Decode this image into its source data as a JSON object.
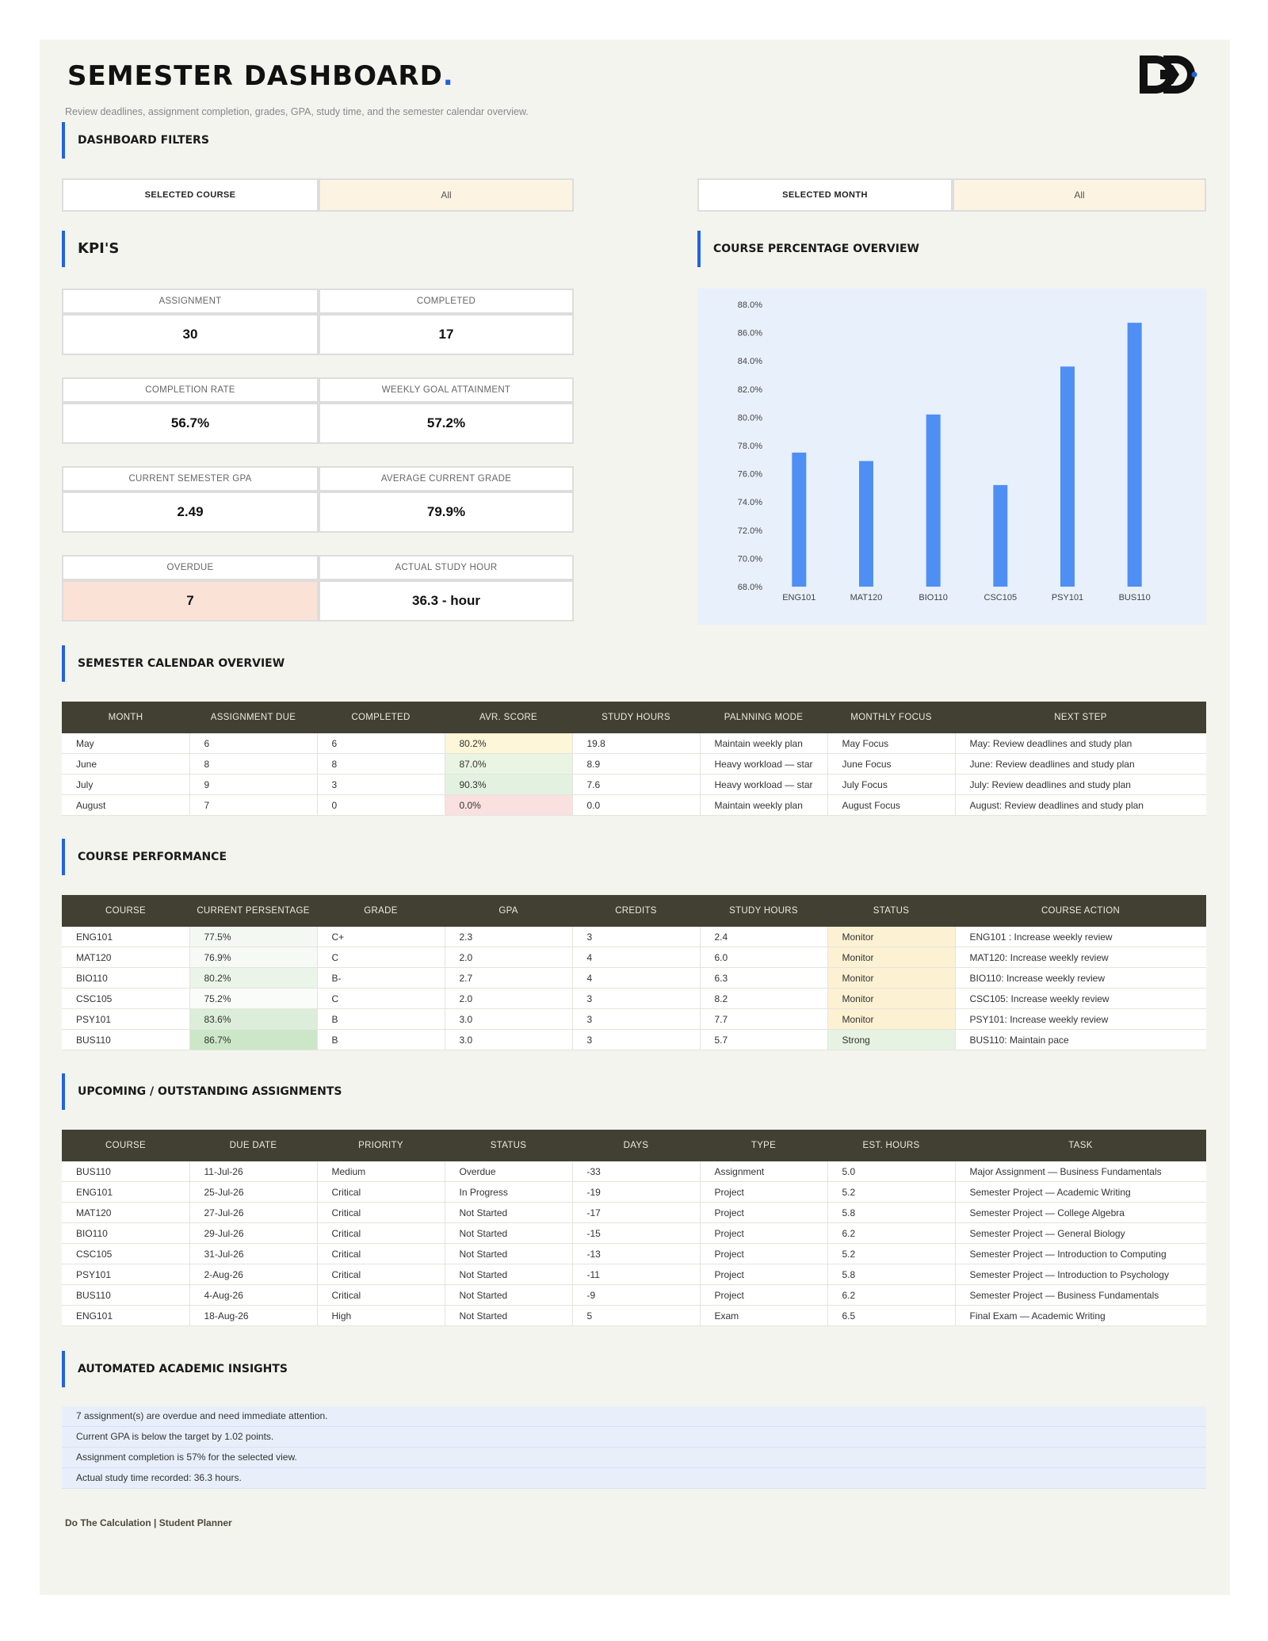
{
  "header": {
    "title": "SEMESTER DASHBOARD",
    "title_dot": ".",
    "subtitle": "Review deadlines, assignment completion, grades, GPA, study time, and the semester calendar overview."
  },
  "sections": {
    "filters": "DASHBOARD FILTERS",
    "kpis": "KPI'S",
    "course_overview": "COURSE PERCENTAGE OVERVIEW",
    "calendar": "SEMESTER CALENDAR OVERVIEW",
    "performance": "COURSE PERFORMANCE",
    "assignments": "UPCOMING / OUTSTANDING ASSIGNMENTS",
    "insights": "AUTOMATED ACADEMIC INSIGHTS"
  },
  "filters": {
    "course_label": "SELECTED COURSE",
    "course_value": "All",
    "month_label": "SELECTED MONTH",
    "month_value": "All"
  },
  "kpis": {
    "assignment_label": "ASSIGNMENT",
    "assignment_value": "30",
    "completed_label": "COMPLETED",
    "completed_value": "17",
    "completion_rate_label": "COMPLETION RATE",
    "completion_rate_value": "56.7%",
    "weekly_goal_label": "WEEKLY GOAL ATTAINMENT",
    "weekly_goal_value": "57.2%",
    "gpa_label": "CURRENT SEMESTER GPA",
    "gpa_value": "2.49",
    "avg_grade_label": "AVERAGE CURRENT GRADE",
    "avg_grade_value": "79.9%",
    "overdue_label": "OVERDUE",
    "overdue_value": "7",
    "study_hour_label": "ACTUAL STUDY HOUR",
    "study_hour_value": "36.3 - hour"
  },
  "colors": {
    "accent": "#2363e0",
    "bar": "#4f8ff4",
    "header_bg": "#414033",
    "overdue_bg": "#fbe2d6",
    "cream": "#fdf3e2"
  },
  "chart_data": {
    "type": "bar",
    "categories": [
      "ENG101",
      "MAT120",
      "BIO110",
      "CSC105",
      "PSY101",
      "BUS110"
    ],
    "values": [
      77.5,
      76.9,
      80.2,
      75.2,
      83.6,
      86.7
    ],
    "ylim": [
      68,
      88
    ],
    "yticks": [
      "68.0%",
      "70.0%",
      "72.0%",
      "74.0%",
      "76.0%",
      "78.0%",
      "80.0%",
      "82.0%",
      "84.0%",
      "86.0%",
      "88.0%"
    ],
    "ytick_values": [
      68,
      70,
      72,
      74,
      76,
      78,
      80,
      82,
      84,
      86,
      88
    ],
    "grid": false,
    "legend": "none"
  },
  "calendar": {
    "headers": [
      "MONTH",
      "ASSIGNMENT DUE",
      "COMPLETED",
      "AVR. SCORE",
      "STUDY HOURS",
      "PALNNING MODE",
      "MONTHLY FOCUS",
      "NEXT STEP"
    ],
    "rows": [
      [
        "May",
        "6",
        "6",
        "80.2%",
        "19.8",
        "Maintain weekly plan",
        "May Focus",
        "May: Review deadlines and study plan"
      ],
      [
        "June",
        "8",
        "8",
        "87.0%",
        "8.9",
        "Heavy workload — star",
        "June Focus",
        "June: Review deadlines and study plan"
      ],
      [
        "July",
        "9",
        "3",
        "90.3%",
        "7.6",
        "Heavy workload — star",
        "July Focus",
        "July: Review deadlines and study plan"
      ],
      [
        "August",
        "7",
        "0",
        "0.0%",
        "0.0",
        "Maintain weekly plan",
        "August Focus",
        "August: Review deadlines and study plan"
      ]
    ],
    "score_colors": [
      "#fdf6d8",
      "#eaf4e3",
      "#e3f1e1",
      "#fbe0e0"
    ]
  },
  "performance": {
    "headers": [
      "COURSE",
      "CURRENT PERSENTAGE",
      "GRADE",
      "GPA",
      "CREDITS",
      "STUDY HOURS",
      "STATUS",
      "COURSE ACTION"
    ],
    "rows": [
      [
        "ENG101",
        "77.5%",
        "C+",
        "2.3",
        "3",
        "2.4",
        "Monitor",
        "ENG101 : Increase weekly review"
      ],
      [
        "MAT120",
        "76.9%",
        "C",
        "2.0",
        "4",
        "6.0",
        "Monitor",
        "MAT120: Increase weekly review"
      ],
      [
        "BIO110",
        "80.2%",
        "B-",
        "2.7",
        "4",
        "6.3",
        "Monitor",
        "BIO110: Increase weekly review"
      ],
      [
        "CSC105",
        "75.2%",
        "C",
        "2.0",
        "3",
        "8.2",
        "Monitor",
        "CSC105: Increase weekly review"
      ],
      [
        "PSY101",
        "83.6%",
        "B",
        "3.0",
        "3",
        "7.7",
        "Monitor",
        "PSY101: Increase weekly review"
      ],
      [
        "BUS110",
        "86.7%",
        "B",
        "3.0",
        "3",
        "5.7",
        "Strong",
        "BUS110: Maintain pace"
      ]
    ],
    "pct_colors": [
      "#f3f8f2",
      "#f6faf5",
      "#eaf4e8",
      "#fafcf9",
      "#dcedd9",
      "#cce6c8"
    ],
    "status_colors": [
      "#fdf1d3",
      "#fdf1d3",
      "#fdf1d3",
      "#fdf1d3",
      "#fdf1d3",
      "#e6f2e2"
    ]
  },
  "assignments": {
    "headers": [
      "COURSE",
      "DUE DATE",
      "PRIORITY",
      "STATUS",
      "DAYS",
      "TYPE",
      "EST. HOURS",
      "TASK"
    ],
    "rows": [
      [
        "BUS110",
        "11-Jul-26",
        "Medium",
        "Overdue",
        "-33",
        "Assignment",
        "5.0",
        "Major Assignment — Business Fundamentals"
      ],
      [
        "ENG101",
        "25-Jul-26",
        "Critical",
        "In Progress",
        "-19",
        "Project",
        "5.2",
        "Semester Project — Academic Writing"
      ],
      [
        "MAT120",
        "27-Jul-26",
        "Critical",
        "Not Started",
        "-17",
        "Project",
        "5.8",
        "Semester Project — College Algebra"
      ],
      [
        "BIO110",
        "29-Jul-26",
        "Critical",
        "Not Started",
        "-15",
        "Project",
        "6.2",
        "Semester Project — General Biology"
      ],
      [
        "CSC105",
        "31-Jul-26",
        "Critical",
        "Not Started",
        "-13",
        "Project",
        "5.2",
        "Semester Project — Introduction to Computing"
      ],
      [
        "PSY101",
        "2-Aug-26",
        "Critical",
        "Not Started",
        "-11",
        "Project",
        "5.8",
        "Semester Project — Introduction to Psychology"
      ],
      [
        "BUS110",
        "4-Aug-26",
        "Critical",
        "Not Started",
        "-9",
        "Project",
        "6.2",
        "Semester Project — Business Fundamentals"
      ],
      [
        "ENG101",
        "18-Aug-26",
        "High",
        "Not Started",
        "5",
        "Exam",
        "6.5",
        "Final Exam — Academic Writing"
      ]
    ]
  },
  "insights": [
    "7 assignment(s) are overdue and need immediate attention.",
    "Current GPA is below the target by 1.02 points.",
    "Assignment completion is 57% for the selected view.",
    "Actual study time recorded: 36.3 hours."
  ],
  "footer": {
    "brand": "Do The Calculation",
    "separator": " | ",
    "product": "Student Planner"
  },
  "logo": {
    "icon": "dtc-logo-icon"
  }
}
